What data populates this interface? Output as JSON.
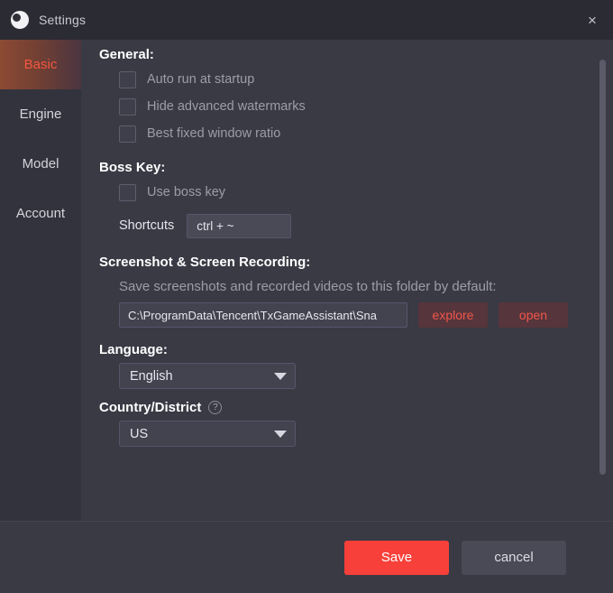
{
  "window": {
    "title": "Settings",
    "logo_icon": "app-logo-icon",
    "close_icon": "×"
  },
  "sidebar": {
    "items": [
      {
        "label": "Basic",
        "active": true
      },
      {
        "label": "Engine",
        "active": false
      },
      {
        "label": "Model",
        "active": false
      },
      {
        "label": "Account",
        "active": false
      }
    ]
  },
  "general": {
    "heading": "General:",
    "options": [
      {
        "label": "Auto run at startup",
        "checked": false
      },
      {
        "label": "Hide advanced watermarks",
        "checked": false
      },
      {
        "label": "Best fixed window ratio",
        "checked": false
      }
    ]
  },
  "boss_key": {
    "heading": "Boss Key:",
    "option": {
      "label": "Use boss key",
      "checked": false
    },
    "shortcuts_label": "Shortcuts",
    "shortcuts_value": "ctrl + ~"
  },
  "screenshot": {
    "heading": "Screenshot & Screen Recording:",
    "description": "Save screenshots and recorded videos to this folder by default:",
    "path_value": "C:\\ProgramData\\Tencent\\TxGameAssistant\\Sna",
    "explore_label": "explore",
    "open_label": "open"
  },
  "language": {
    "heading": "Language:",
    "selected": "English"
  },
  "country": {
    "heading": "Country/District",
    "help_icon": "?",
    "selected": "US"
  },
  "footer": {
    "save_label": "Save",
    "cancel_label": "cancel"
  },
  "colors": {
    "accent_red": "#f7403a",
    "active_tab_text": "#f2563f",
    "window_bg": "#3a3a45",
    "titlebar_bg": "#2b2b33",
    "sidebar_bg": "#33333d"
  }
}
